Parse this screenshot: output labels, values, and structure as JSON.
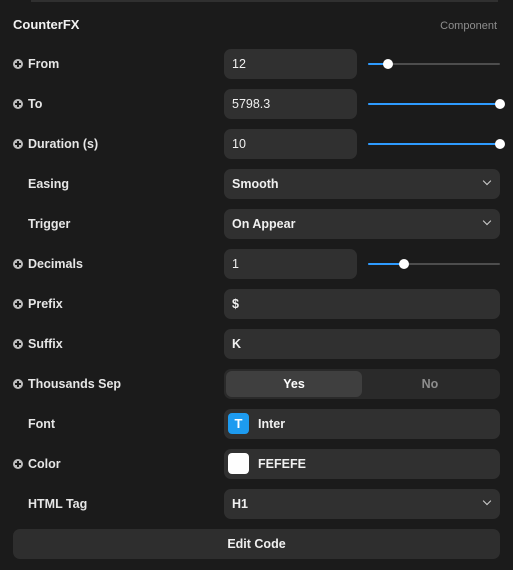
{
  "header": {
    "title": "CounterFX",
    "tag": "Component"
  },
  "accent_color": "#2e9bff",
  "fields": {
    "from": {
      "label": "From",
      "value": "12",
      "slider_fraction": 0.15
    },
    "to": {
      "label": "To",
      "value": "5798.3",
      "slider_fraction": 1.0
    },
    "duration": {
      "label": "Duration (s)",
      "value": "10",
      "slider_fraction": 1.0
    },
    "easing": {
      "label": "Easing",
      "value": "Smooth"
    },
    "trigger": {
      "label": "Trigger",
      "value": "On Appear"
    },
    "decimals": {
      "label": "Decimals",
      "value": "1",
      "slider_fraction": 0.27
    },
    "prefix": {
      "label": "Prefix",
      "value": "$"
    },
    "suffix": {
      "label": "Suffix",
      "value": "K"
    },
    "thousands_sep": {
      "label": "Thousands Sep",
      "yes": "Yes",
      "no": "No",
      "selected": "Yes"
    },
    "font": {
      "label": "Font",
      "value": "Inter",
      "icon_letter": "T",
      "icon": "font-type-icon"
    },
    "color": {
      "label": "Color",
      "value": "FEFEFE",
      "swatch": "#fefefe"
    },
    "html_tag": {
      "label": "HTML Tag",
      "value": "H1"
    }
  },
  "edit_code_label": "Edit Code"
}
